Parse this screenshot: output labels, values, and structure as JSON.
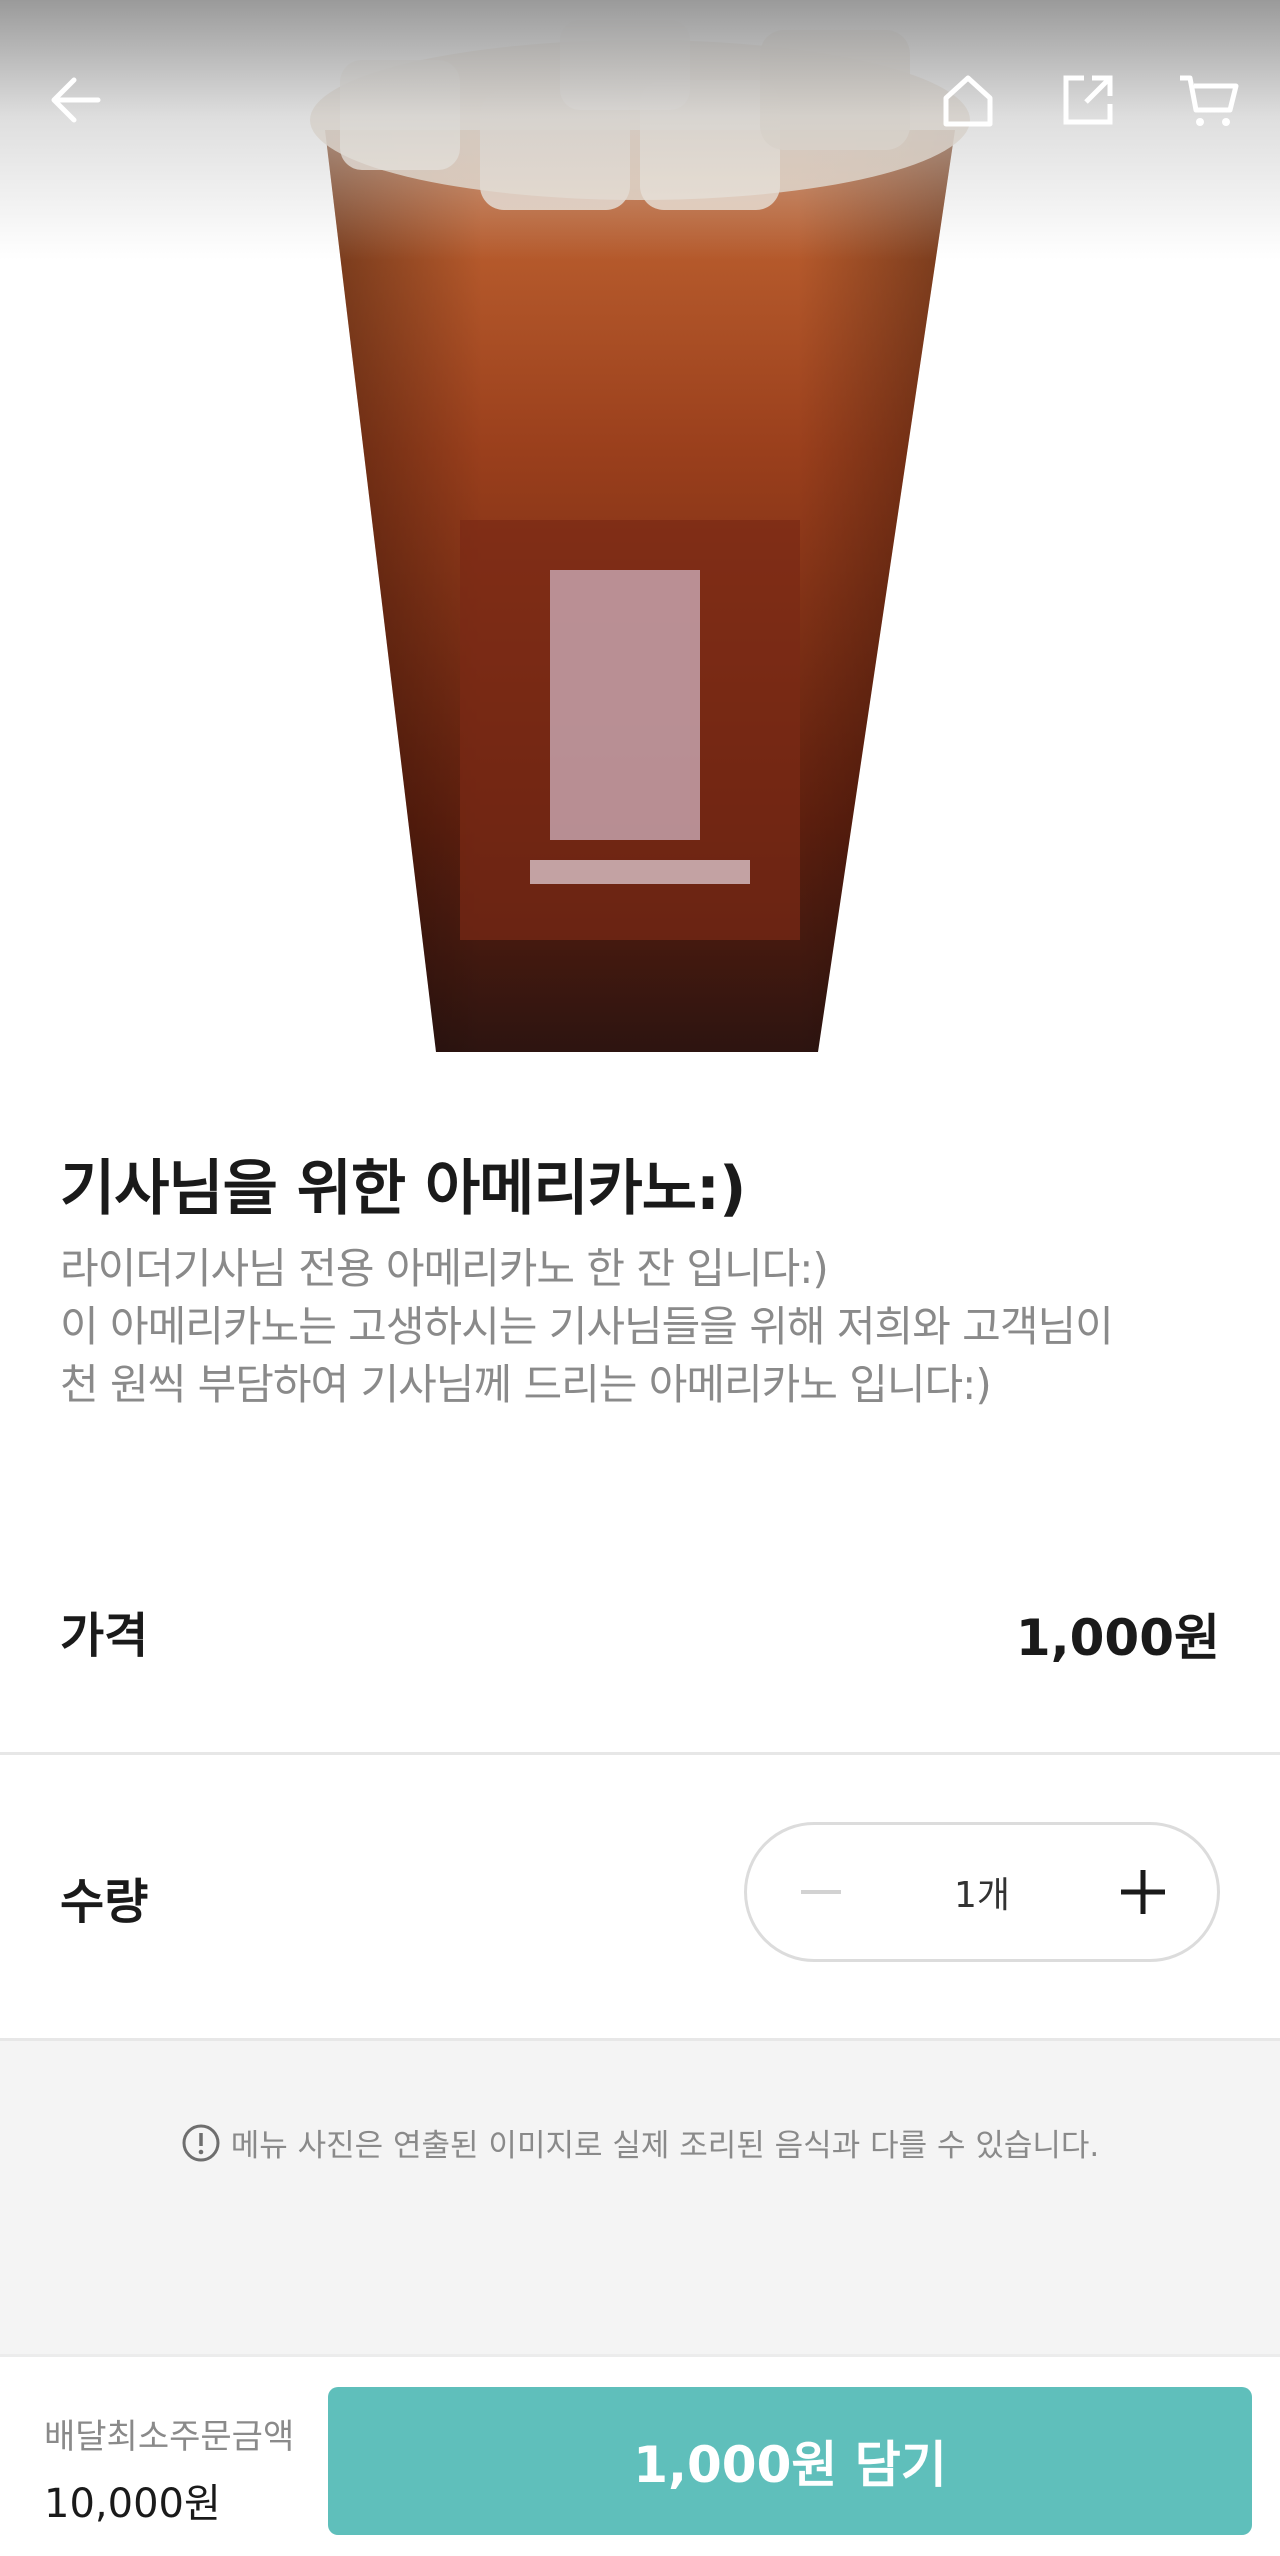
{
  "header": {
    "back_icon": "arrow-left-icon",
    "home_icon": "home-icon",
    "share_icon": "share-icon",
    "cart_icon": "cart-icon"
  },
  "product": {
    "image_description": "iced americano in plastic cup",
    "title": "기사님을 위한 아메리카노:)",
    "description_lines": [
      "라이더기사님 전용 아메리카노 한 잔 입니다:)",
      "이 아메리카노는 고생하시는 기사님들을 위해 저희와 고객님이",
      "천 원씩 부담하여 기사님께 드리는 아메리카노 입니다:)"
    ]
  },
  "price": {
    "label": "가격",
    "value": "1,000원"
  },
  "quantity": {
    "label": "수량",
    "value": "1개",
    "minus_icon": "minus-icon",
    "plus_icon": "plus-icon"
  },
  "notice": {
    "icon": "info-icon",
    "text": "메뉴 사진은 연출된 이미지로 실제 조리된 음식과 다를 수 있습니다."
  },
  "footer": {
    "min_order_label": "배달최소주문금액",
    "min_order_value": "10,000원",
    "add_button_label": "1,000원 담기"
  },
  "colors": {
    "accent": "#5fbfbb",
    "notice_bg": "#f4f4f4",
    "muted_text": "#8a8a8a"
  }
}
